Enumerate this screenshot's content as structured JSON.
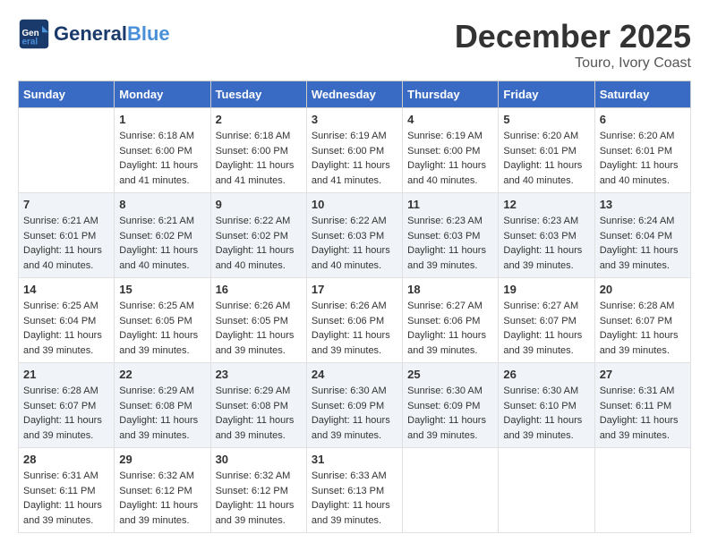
{
  "header": {
    "logo_text_general": "General",
    "logo_text_blue": "Blue",
    "month_title": "December 2025",
    "location": "Touro, Ivory Coast"
  },
  "weekdays": [
    "Sunday",
    "Monday",
    "Tuesday",
    "Wednesday",
    "Thursday",
    "Friday",
    "Saturday"
  ],
  "weeks": [
    {
      "group": 1,
      "days": [
        {
          "num": "",
          "info": ""
        },
        {
          "num": "1",
          "info": "Sunrise: 6:18 AM\nSunset: 6:00 PM\nDaylight: 11 hours\nand 41 minutes."
        },
        {
          "num": "2",
          "info": "Sunrise: 6:18 AM\nSunset: 6:00 PM\nDaylight: 11 hours\nand 41 minutes."
        },
        {
          "num": "3",
          "info": "Sunrise: 6:19 AM\nSunset: 6:00 PM\nDaylight: 11 hours\nand 41 minutes."
        },
        {
          "num": "4",
          "info": "Sunrise: 6:19 AM\nSunset: 6:00 PM\nDaylight: 11 hours\nand 40 minutes."
        },
        {
          "num": "5",
          "info": "Sunrise: 6:20 AM\nSunset: 6:01 PM\nDaylight: 11 hours\nand 40 minutes."
        },
        {
          "num": "6",
          "info": "Sunrise: 6:20 AM\nSunset: 6:01 PM\nDaylight: 11 hours\nand 40 minutes."
        }
      ]
    },
    {
      "group": 2,
      "days": [
        {
          "num": "7",
          "info": "Sunrise: 6:21 AM\nSunset: 6:01 PM\nDaylight: 11 hours\nand 40 minutes."
        },
        {
          "num": "8",
          "info": "Sunrise: 6:21 AM\nSunset: 6:02 PM\nDaylight: 11 hours\nand 40 minutes."
        },
        {
          "num": "9",
          "info": "Sunrise: 6:22 AM\nSunset: 6:02 PM\nDaylight: 11 hours\nand 40 minutes."
        },
        {
          "num": "10",
          "info": "Sunrise: 6:22 AM\nSunset: 6:03 PM\nDaylight: 11 hours\nand 40 minutes."
        },
        {
          "num": "11",
          "info": "Sunrise: 6:23 AM\nSunset: 6:03 PM\nDaylight: 11 hours\nand 39 minutes."
        },
        {
          "num": "12",
          "info": "Sunrise: 6:23 AM\nSunset: 6:03 PM\nDaylight: 11 hours\nand 39 minutes."
        },
        {
          "num": "13",
          "info": "Sunrise: 6:24 AM\nSunset: 6:04 PM\nDaylight: 11 hours\nand 39 minutes."
        }
      ]
    },
    {
      "group": 3,
      "days": [
        {
          "num": "14",
          "info": "Sunrise: 6:25 AM\nSunset: 6:04 PM\nDaylight: 11 hours\nand 39 minutes."
        },
        {
          "num": "15",
          "info": "Sunrise: 6:25 AM\nSunset: 6:05 PM\nDaylight: 11 hours\nand 39 minutes."
        },
        {
          "num": "16",
          "info": "Sunrise: 6:26 AM\nSunset: 6:05 PM\nDaylight: 11 hours\nand 39 minutes."
        },
        {
          "num": "17",
          "info": "Sunrise: 6:26 AM\nSunset: 6:06 PM\nDaylight: 11 hours\nand 39 minutes."
        },
        {
          "num": "18",
          "info": "Sunrise: 6:27 AM\nSunset: 6:06 PM\nDaylight: 11 hours\nand 39 minutes."
        },
        {
          "num": "19",
          "info": "Sunrise: 6:27 AM\nSunset: 6:07 PM\nDaylight: 11 hours\nand 39 minutes."
        },
        {
          "num": "20",
          "info": "Sunrise: 6:28 AM\nSunset: 6:07 PM\nDaylight: 11 hours\nand 39 minutes."
        }
      ]
    },
    {
      "group": 4,
      "days": [
        {
          "num": "21",
          "info": "Sunrise: 6:28 AM\nSunset: 6:07 PM\nDaylight: 11 hours\nand 39 minutes."
        },
        {
          "num": "22",
          "info": "Sunrise: 6:29 AM\nSunset: 6:08 PM\nDaylight: 11 hours\nand 39 minutes."
        },
        {
          "num": "23",
          "info": "Sunrise: 6:29 AM\nSunset: 6:08 PM\nDaylight: 11 hours\nand 39 minutes."
        },
        {
          "num": "24",
          "info": "Sunrise: 6:30 AM\nSunset: 6:09 PM\nDaylight: 11 hours\nand 39 minutes."
        },
        {
          "num": "25",
          "info": "Sunrise: 6:30 AM\nSunset: 6:09 PM\nDaylight: 11 hours\nand 39 minutes."
        },
        {
          "num": "26",
          "info": "Sunrise: 6:30 AM\nSunset: 6:10 PM\nDaylight: 11 hours\nand 39 minutes."
        },
        {
          "num": "27",
          "info": "Sunrise: 6:31 AM\nSunset: 6:11 PM\nDaylight: 11 hours\nand 39 minutes."
        }
      ]
    },
    {
      "group": 5,
      "days": [
        {
          "num": "28",
          "info": "Sunrise: 6:31 AM\nSunset: 6:11 PM\nDaylight: 11 hours\nand 39 minutes."
        },
        {
          "num": "29",
          "info": "Sunrise: 6:32 AM\nSunset: 6:12 PM\nDaylight: 11 hours\nand 39 minutes."
        },
        {
          "num": "30",
          "info": "Sunrise: 6:32 AM\nSunset: 6:12 PM\nDaylight: 11 hours\nand 39 minutes."
        },
        {
          "num": "31",
          "info": "Sunrise: 6:33 AM\nSunset: 6:13 PM\nDaylight: 11 hours\nand 39 minutes."
        },
        {
          "num": "",
          "info": ""
        },
        {
          "num": "",
          "info": ""
        },
        {
          "num": "",
          "info": ""
        }
      ]
    }
  ]
}
